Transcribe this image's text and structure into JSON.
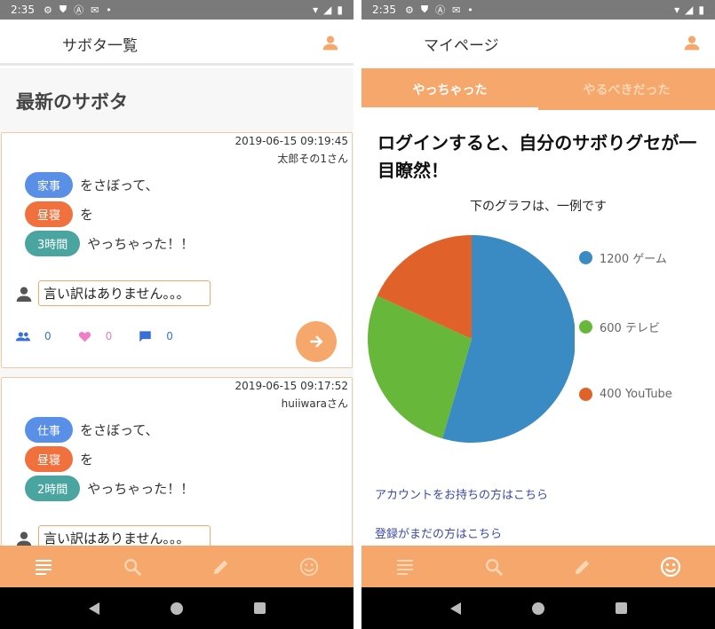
{
  "status_bar": {
    "time": "2:35"
  },
  "left": {
    "app_title": "サボタ一覧",
    "section_title": "最新のサボタ",
    "posts": [
      {
        "date": "2019-06-15 09:19:45",
        "author": "太郎その1さん",
        "skipped": "家事",
        "skipped_suffix": "をさぼって、",
        "did": "昼寝",
        "did_suffix": "を",
        "duration": "3時間",
        "duration_suffix": "やっちゃった！！",
        "excuse": "言い訳はありません。。。",
        "likes_people": "0",
        "likes_heart": "0",
        "comments": "0"
      },
      {
        "date": "2019-06-15 09:17:52",
        "author": "huiiwaraさん",
        "skipped": "仕事",
        "skipped_suffix": "をさぼって、",
        "did": "昼寝",
        "did_suffix": "を",
        "duration": "2時間",
        "duration_suffix": "やっちゃった！！",
        "excuse": "言い訳はありません。。。"
      }
    ]
  },
  "right": {
    "app_title": "マイページ",
    "tabs": [
      {
        "label": "やっちゃった"
      },
      {
        "label": "やるべきだった"
      }
    ],
    "headline": "ログインすると、自分のサボりグセが一目瞭然！",
    "subtitle": "下のグラフは、一例です",
    "legend": [
      "1200 ゲーム",
      "600 テレビ",
      "400 YouTube"
    ],
    "link_login": "アカウントをお持ちの方はこちら",
    "link_register": "登録がまだの方はこちら"
  },
  "chart_data": {
    "type": "pie",
    "title": "",
    "categories": [
      "ゲーム",
      "テレビ",
      "YouTube"
    ],
    "values": [
      1200,
      600,
      400
    ],
    "colors": [
      "#3a8ac4",
      "#67b83a",
      "#e0622a"
    ]
  },
  "colors": {
    "accent": "#f6a86c",
    "pill_blue": "#5a8fe8",
    "pill_orange": "#f0703e",
    "pill_teal": "#4aa4a0",
    "link": "#3a49a8"
  },
  "icons": {
    "nav": [
      "list-icon",
      "search-icon",
      "pencil-icon",
      "smiley-icon"
    ],
    "stats": [
      "people-icon",
      "heart-icon",
      "comment-icon"
    ]
  }
}
